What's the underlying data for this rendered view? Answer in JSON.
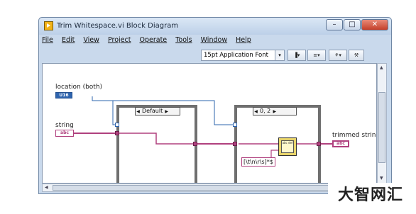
{
  "window": {
    "title": "Trim Whitespace.vi Block Diagram",
    "controls": {
      "minimize": "–",
      "maximize": "□",
      "close": "✕"
    }
  },
  "menubar": {
    "items": [
      "File",
      "Edit",
      "View",
      "Project",
      "Operate",
      "Tools",
      "Window",
      "Help"
    ]
  },
  "toolbar": {
    "font_select": "15pt Application Font",
    "font_arrow": "▾",
    "buttons": [
      {
        "name": "align-objects",
        "icon": "align-icon",
        "label": "▐▾"
      },
      {
        "name": "distribute-objects",
        "icon": "distribute-icon",
        "label": "≡▾"
      },
      {
        "name": "reorder",
        "icon": "reorder-icon",
        "label": "⚘▾"
      },
      {
        "name": "cleanup-diagram",
        "icon": "cleanup-icon",
        "label": "⚒"
      }
    ]
  },
  "diagram": {
    "location_label": "location (both)",
    "location_terminal": "U16",
    "string_label": "string",
    "string_terminal": "abc",
    "case1_selector": "Default",
    "case2_selector": "0, 2",
    "output_label": "trimmed string",
    "output_terminal": "abc",
    "regex_constant": "[\\t\\n\\r\\s]*$",
    "function_text": "abc def"
  },
  "watermark": "大智网汇",
  "colors": {
    "string_wire": "#b0407e",
    "numeric_wire": "#2e64ae",
    "case_frame": "#6f6f6f",
    "window_frame": "#c9d9ec"
  }
}
